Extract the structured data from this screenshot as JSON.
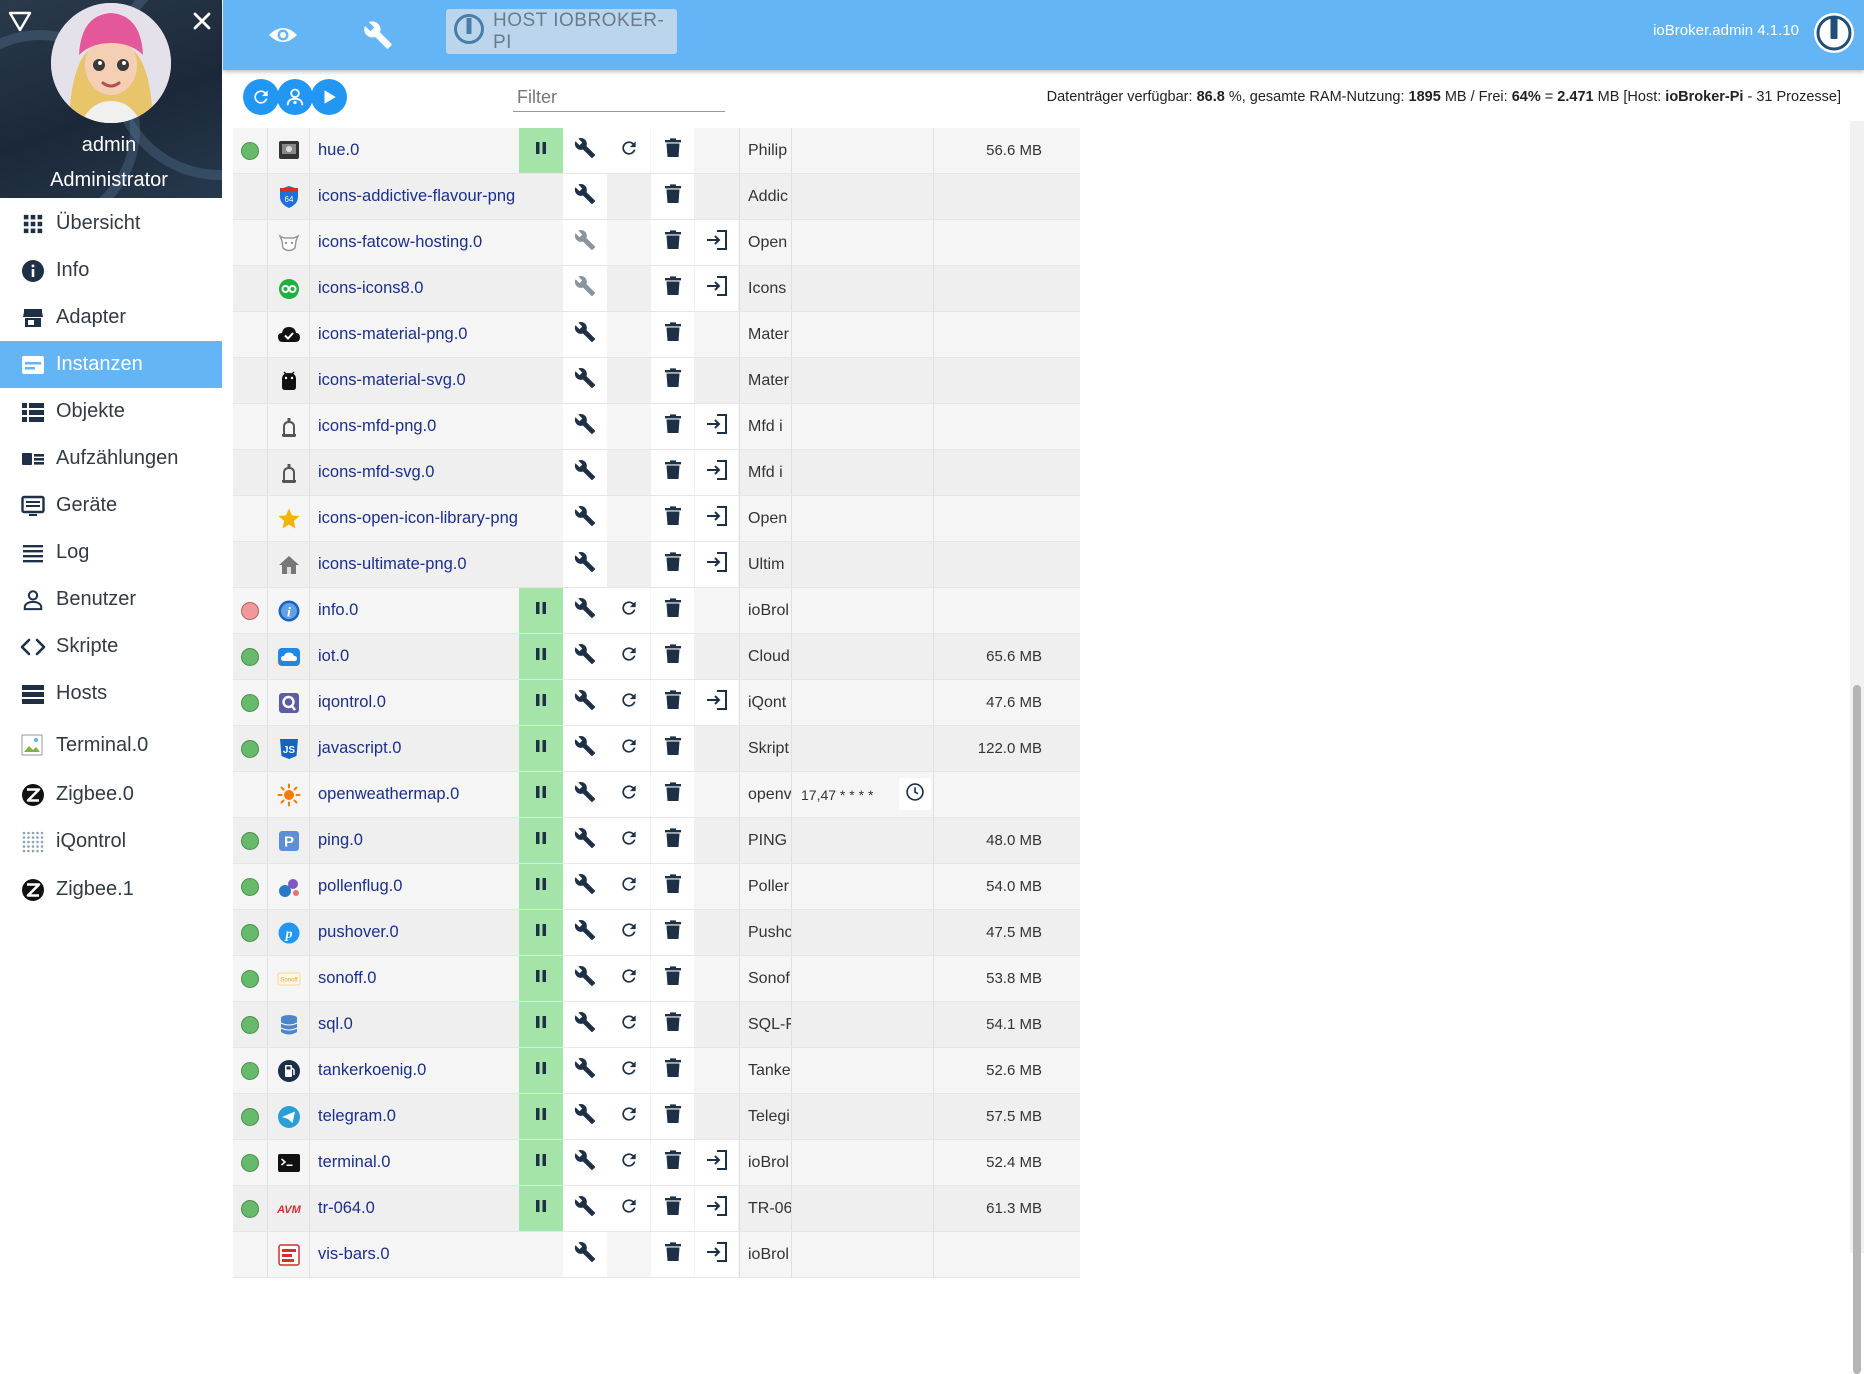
{
  "app": {
    "host_button": "HOST IOBROKER-PI",
    "version": "ioBroker.admin 4.1.10"
  },
  "user": {
    "name": "admin",
    "role": "Administrator"
  },
  "nav": [
    {
      "label": "Übersicht",
      "icon": "grid-icon"
    },
    {
      "label": "Info",
      "icon": "info-icon"
    },
    {
      "label": "Adapter",
      "icon": "store-icon"
    },
    {
      "label": "Instanzen",
      "icon": "instances-icon",
      "active": true
    },
    {
      "label": "Objekte",
      "icon": "list-icon"
    },
    {
      "label": "Aufzählungen",
      "icon": "enum-icon"
    },
    {
      "label": "Geräte",
      "icon": "devices-icon"
    },
    {
      "label": "Log",
      "icon": "log-icon"
    },
    {
      "label": "Benutzer",
      "icon": "user-icon"
    },
    {
      "label": "Skripte",
      "icon": "code-icon"
    },
    {
      "label": "Hosts",
      "icon": "hosts-icon"
    },
    {
      "label": "Terminal.0",
      "icon": "broken-image-icon"
    },
    {
      "label": "Zigbee.0",
      "icon": "zigbee-icon"
    },
    {
      "label": "iQontrol",
      "icon": "iqontrol-icon"
    },
    {
      "label": "Zigbee.1",
      "icon": "zigbee-icon"
    }
  ],
  "filter": {
    "placeholder": "Filter",
    "value": ""
  },
  "host_status": {
    "disk_label": "Datenträger verfügbar:",
    "disk_value": "86.8",
    "ram_label": "%, gesamte RAM-Nutzung:",
    "ram_total": "1895",
    "free_label": "MB / Frei:",
    "free_pct": "64%",
    "eq": "=",
    "free_mb": "2.471",
    "host_label": "MB [Host:",
    "host_name": "ioBroker-Pi",
    "processes": "- 31 Prozesse]"
  },
  "instances": [
    {
      "name": "hue.0",
      "status": "green",
      "running": true,
      "title": "Philip",
      "memory": "56.6 MB",
      "icon": "hue-icon",
      "icon_color": "#333333",
      "wrench_dim": false,
      "link": false
    },
    {
      "name": "icons-addictive-flavour-png",
      "status": "none",
      "running": false,
      "title": "Addic",
      "memory": "",
      "icon": "shield-64-icon",
      "icon_color": "#1e6fd9",
      "wrench_dim": false,
      "link": false
    },
    {
      "name": "icons-fatcow-hosting.0",
      "status": "none",
      "running": false,
      "title": "Open",
      "memory": "",
      "icon": "cow-icon",
      "icon_color": "#999999",
      "wrench_dim": true,
      "link": true
    },
    {
      "name": "icons-icons8.0",
      "status": "none",
      "running": false,
      "title": "Icons",
      "memory": "",
      "icon": "icons8-icon",
      "icon_color": "#1fb141",
      "wrench_dim": true,
      "link": true
    },
    {
      "name": "icons-material-png.0",
      "status": "none",
      "running": false,
      "title": "Mater",
      "memory": "",
      "icon": "cloud-check-icon",
      "icon_color": "#111111",
      "wrench_dim": false,
      "link": false
    },
    {
      "name": "icons-material-svg.0",
      "status": "none",
      "running": false,
      "title": "Mater",
      "memory": "",
      "icon": "android-icon",
      "icon_color": "#111111",
      "wrench_dim": false,
      "link": false
    },
    {
      "name": "icons-mfd-png.0",
      "status": "none",
      "running": false,
      "title": "Mfd i",
      "memory": "",
      "icon": "mfd-icon",
      "icon_color": "#555555",
      "wrench_dim": false,
      "link": true
    },
    {
      "name": "icons-mfd-svg.0",
      "status": "none",
      "running": false,
      "title": "Mfd i",
      "memory": "",
      "icon": "mfd-icon",
      "icon_color": "#555555",
      "wrench_dim": false,
      "link": true
    },
    {
      "name": "icons-open-icon-library-png",
      "status": "none",
      "running": false,
      "title": "Open",
      "memory": "",
      "icon": "star-icon",
      "icon_color": "#f5b301",
      "wrench_dim": false,
      "link": true
    },
    {
      "name": "icons-ultimate-png.0",
      "status": "none",
      "running": false,
      "title": "Ultim",
      "memory": "",
      "icon": "house-icon",
      "icon_color": "#777777",
      "wrench_dim": false,
      "link": true
    },
    {
      "name": "info.0",
      "status": "red",
      "running": true,
      "title": "ioBrol",
      "memory": "",
      "icon": "info-circle-icon",
      "icon_color": "#1565c0",
      "wrench_dim": false,
      "link": false
    },
    {
      "name": "iot.0",
      "status": "green",
      "running": true,
      "title": "Cloud",
      "memory": "65.6 MB",
      "icon": "cloud-icon",
      "icon_color": "#1e88e5",
      "wrench_dim": false,
      "link": false
    },
    {
      "name": "iqontrol.0",
      "status": "green",
      "running": true,
      "title": "iQont",
      "memory": "47.6 MB",
      "icon": "iqontrol-q-icon",
      "icon_color": "#5c5c9e",
      "wrench_dim": false,
      "link": true
    },
    {
      "name": "javascript.0",
      "status": "green",
      "running": true,
      "title": "Skript",
      "memory": "122.0 MB",
      "icon": "js-icon",
      "icon_color": "#1565c0",
      "wrench_dim": false,
      "link": false
    },
    {
      "name": "openweathermap.0",
      "status": "none",
      "running": true,
      "title": "openv",
      "memory": "",
      "icon": "sun-icon",
      "icon_color": "#f57c00",
      "wrench_dim": false,
      "link": false,
      "schedule": "17,47 * * * *"
    },
    {
      "name": "ping.0",
      "status": "green",
      "running": true,
      "title": "PING",
      "memory": "48.0 MB",
      "icon": "ping-p-icon",
      "icon_color": "#5c8fd6",
      "wrench_dim": false,
      "link": false
    },
    {
      "name": "pollenflug.0",
      "status": "green",
      "running": true,
      "title": "Poller",
      "memory": "54.0 MB",
      "icon": "pollen-icon",
      "icon_color": "#2979c7",
      "wrench_dim": false,
      "link": false
    },
    {
      "name": "pushover.0",
      "status": "green",
      "running": true,
      "title": "Pushc",
      "memory": "47.5 MB",
      "icon": "pushover-icon",
      "icon_color": "#2196f3",
      "wrench_dim": false,
      "link": false
    },
    {
      "name": "sonoff.0",
      "status": "green",
      "running": true,
      "title": "Sonof",
      "memory": "53.8 MB",
      "icon": "sonoff-icon",
      "icon_color": "#f0a030",
      "wrench_dim": false,
      "link": false
    },
    {
      "name": "sql.0",
      "status": "green",
      "running": true,
      "title": "SQL-F",
      "memory": "54.1 MB",
      "icon": "database-icon",
      "icon_color": "#4a86c8",
      "wrench_dim": false,
      "link": false
    },
    {
      "name": "tankerkoenig.0",
      "status": "green",
      "running": true,
      "title": "Tanke",
      "memory": "52.6 MB",
      "icon": "fuel-icon",
      "icon_color": "#1c2f4a",
      "wrench_dim": false,
      "link": false
    },
    {
      "name": "telegram.0",
      "status": "green",
      "running": true,
      "title": "Telegi",
      "memory": "57.5 MB",
      "icon": "telegram-icon",
      "icon_color": "#2a9fd6",
      "wrench_dim": false,
      "link": false
    },
    {
      "name": "terminal.0",
      "status": "green",
      "running": true,
      "title": "ioBrol",
      "memory": "52.4 MB",
      "icon": "terminal-icon",
      "icon_color": "#111111",
      "wrench_dim": false,
      "link": true
    },
    {
      "name": "tr-064.0",
      "status": "green",
      "running": true,
      "title": "TR-06",
      "memory": "61.3 MB",
      "icon": "avm-icon",
      "icon_color": "#d32f2f",
      "wrench_dim": false,
      "link": true
    },
    {
      "name": "vis-bars.0",
      "status": "none",
      "running": false,
      "title": "ioBrol",
      "memory": "",
      "icon": "vis-bars-icon",
      "icon_color": "#d32f2f",
      "wrench_dim": false,
      "link": true
    }
  ]
}
